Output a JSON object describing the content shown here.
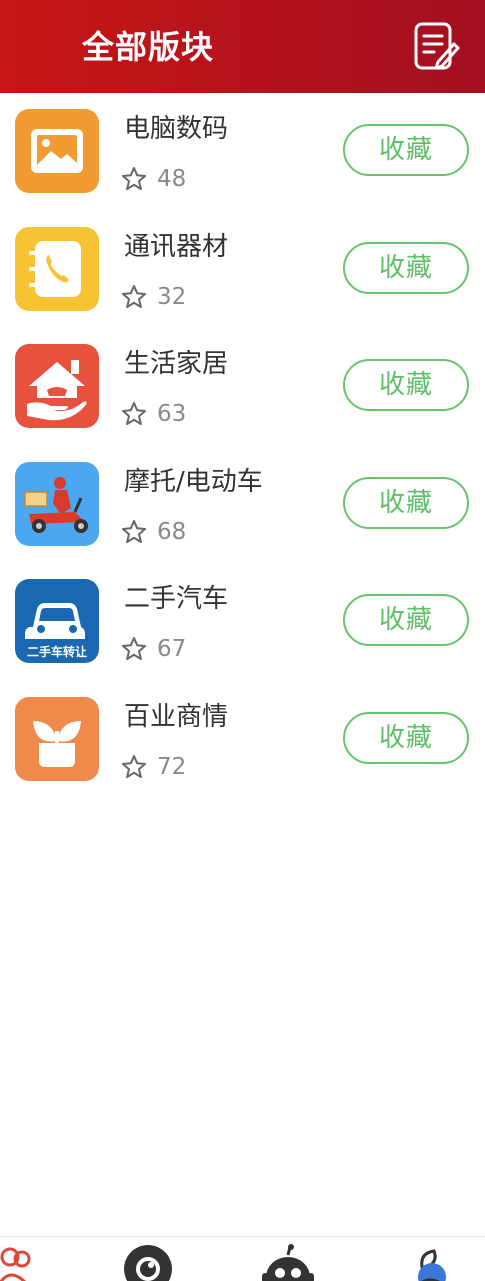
{
  "header": {
    "title": "全部版块"
  },
  "boards": [
    {
      "name": "电脑数码",
      "count": "48",
      "fav": "收藏",
      "icon": "picture-icon",
      "color": "#f39b33"
    },
    {
      "name": "通讯器材",
      "count": "32",
      "fav": "收藏",
      "icon": "phone-book-icon",
      "color": "#f7c233"
    },
    {
      "name": "生活家居",
      "count": "63",
      "fav": "收藏",
      "icon": "home-hand-icon",
      "color": "#e8513d"
    },
    {
      "name": "摩托/电动车",
      "count": "68",
      "fav": "收藏",
      "icon": "scooter-rider-icon",
      "color": "#4ba8f0"
    },
    {
      "name": "二手汽车",
      "count": "67",
      "fav": "收藏",
      "icon": "used-car-icon",
      "color": "#1b68b2",
      "icon_text": "二手车转让"
    },
    {
      "name": "百业商情",
      "count": "72",
      "fav": "收藏",
      "icon": "plant-pot-icon",
      "color": "#f08a4b"
    }
  ],
  "colors": {
    "header_start": "#c61515",
    "header_end": "#a31021",
    "accent_green": "#5fbf66"
  },
  "tabbar": [
    {
      "icon": "people-icon"
    },
    {
      "icon": "camera-lens-icon"
    },
    {
      "icon": "robot-icon"
    },
    {
      "icon": "profile-icon"
    }
  ]
}
